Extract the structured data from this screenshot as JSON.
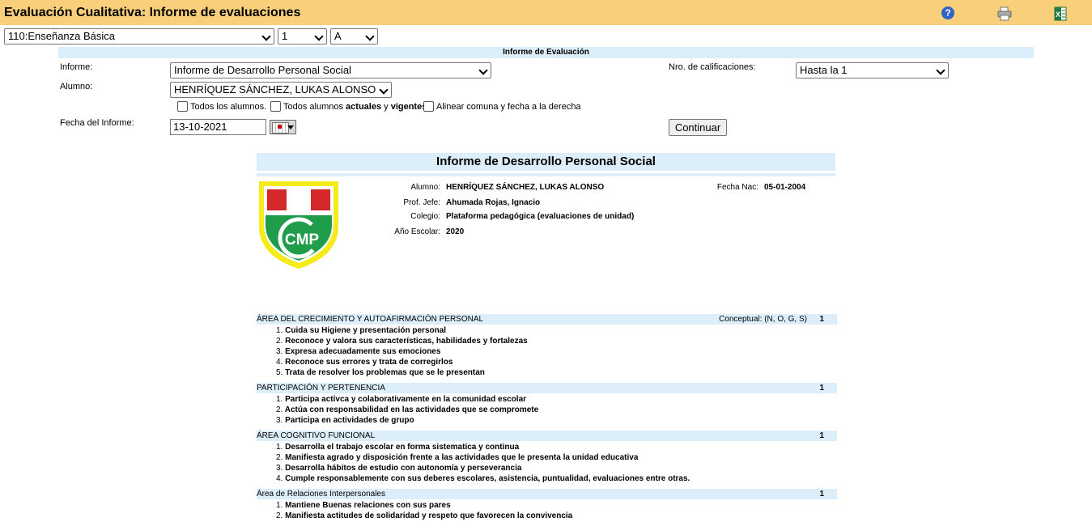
{
  "header": {
    "title": "Evaluación Cualitativa: Informe de evaluaciones",
    "help_icon": "?"
  },
  "filters": {
    "level": "110:Enseñanza Básica",
    "grade": "1",
    "section": "A"
  },
  "form": {
    "band_title": "Informe de Evaluación",
    "informe_label": "Informe:",
    "informe_value": "Informe de Desarrollo Personal Social",
    "nro_label": "Nro. de calificaciones:",
    "nro_value": "Hasta la 1",
    "alumno_label": "Alumno:",
    "alumno_value": "HENRÍQUEZ SÁNCHEZ, LUKAS ALONSO",
    "cb_todos": "Todos los alumnos.",
    "cb_vig_pre": "Todos alumnos ",
    "cb_vig_b1": "actuales",
    "cb_vig_mid": " y ",
    "cb_vig_b2": "vigentes",
    "cb_alinear": "Alinear comuna y fecha a la derecha",
    "fecha_label": "Fecha del Informe:",
    "fecha_value": "13-10-2021",
    "continuar": "Continuar"
  },
  "report": {
    "title": "Informe de Desarrollo Personal Social",
    "alumno_label": "Alumno:",
    "alumno": "HENRÍQUEZ SÁNCHEZ, LUKAS ALONSO",
    "fnac_label": "Fecha Nac:",
    "fnac": "05-01-2004",
    "prof_label": "Prof. Jefe:",
    "prof": "Ahumada Rojas, Ignacio",
    "colegio_label": "Colegio:",
    "colegio": "Plataforma pedagógica (evaluaciones de unidad)",
    "anio_label": "Año Escolar:",
    "anio": "2020",
    "logo_text": "CMP"
  },
  "sections": [
    {
      "title": "ÁREA DEL CRECIMIENTO Y AUTOAFIRMACIÓN PERSONAL",
      "scale_label": "Conceptual: (N, O, G, S)",
      "col": "1",
      "items": [
        {
          "num": "1.",
          "text": "Cuida su Higiene y presentación personal"
        },
        {
          "num": "2.",
          "text": "Reconoce y valora sus características, habilidades y fortalezas"
        },
        {
          "num": "3.",
          "text": "Expresa adecuadamente sus emociones"
        },
        {
          "num": "4.",
          "text": "Reconoce sus errores y trata de corregirlos"
        },
        {
          "num": "5.",
          "text": "Trata de resolver los problemas que se le presentan"
        }
      ]
    },
    {
      "title": "PARTICIPACIÓN Y PERTENENCIA",
      "col": "1",
      "items": [
        {
          "num": "1.",
          "text": "Participa activca y colaborativamente en la comunidad escolar"
        },
        {
          "num": "2.",
          "text": "Actúa con responsabilidad en las actividades que se compromete"
        },
        {
          "num": "3.",
          "text": "Participa en actividades de grupo"
        }
      ]
    },
    {
      "title": "ÁREA COGNITIVO FUNCIONAL",
      "col": "1",
      "items": [
        {
          "num": "1.",
          "text": "Desarrolla el trabajo escolar en forma sistematica y continua"
        },
        {
          "num": "2.",
          "text": "Manifiesta agrado y disposición frente a las actividades que le presenta la unidad educativa"
        },
        {
          "num": "3.",
          "text": "Desarrolla hábitos de estudio con autonomía y perseverancia"
        },
        {
          "num": "4.",
          "text": "Cumple responsablemente con sus deberes escolares, asistencia, puntualidad, evaluaciones entre otras."
        }
      ]
    },
    {
      "title": "Área de Relaciones Interpersonales",
      "col": "1",
      "items": [
        {
          "num": "1.",
          "text": "Mantiene Buenas relaciones con sus pares"
        },
        {
          "num": "2.",
          "text": "Manifiesta actitudes de solidaridad y respeto que favorecen la convivencia"
        }
      ]
    }
  ]
}
